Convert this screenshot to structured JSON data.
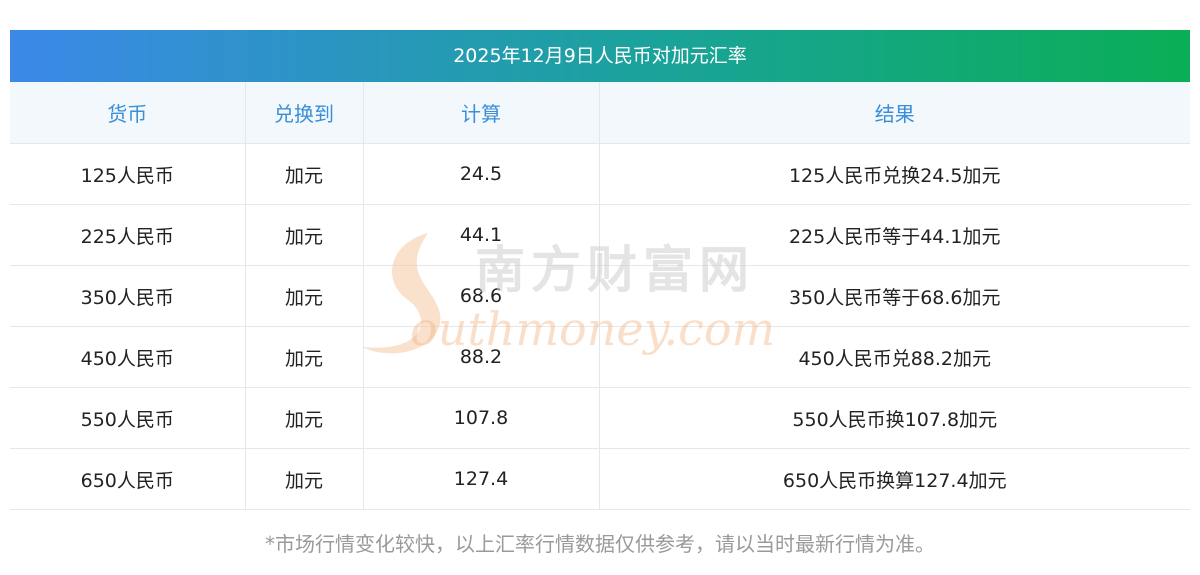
{
  "title": "2025年12月9日人民币对加元汇率",
  "table": {
    "headers": [
      "货币",
      "兑换到",
      "计算",
      "结果"
    ],
    "rows": [
      [
        "125人民币",
        "加元",
        "24.5",
        "125人民币兑换24.5加元"
      ],
      [
        "225人民币",
        "加元",
        "44.1",
        "225人民币等于44.1加元"
      ],
      [
        "350人民币",
        "加元",
        "68.6",
        "350人民币等于68.6加元"
      ],
      [
        "450人民币",
        "加元",
        "88.2",
        "450人民币兑88.2加元"
      ],
      [
        "550人民币",
        "加元",
        "107.8",
        "550人民币换107.8加元"
      ],
      [
        "650人民币",
        "加元",
        "127.4",
        "650人民币换算127.4加元"
      ]
    ]
  },
  "watermark": {
    "cn": "南方财富网",
    "en": "outhmoney.com"
  },
  "footnote": "*市场行情变化较快，以上汇率行情数据仅供参考，请以当时最新行情为准。",
  "colors": {
    "title_gradient_start": "#3b88e8",
    "title_gradient_end": "#0aae55",
    "header_text": "#3a8fd8",
    "header_bg": "#f3f8fd",
    "footnote_text": "#9a9a9a"
  }
}
